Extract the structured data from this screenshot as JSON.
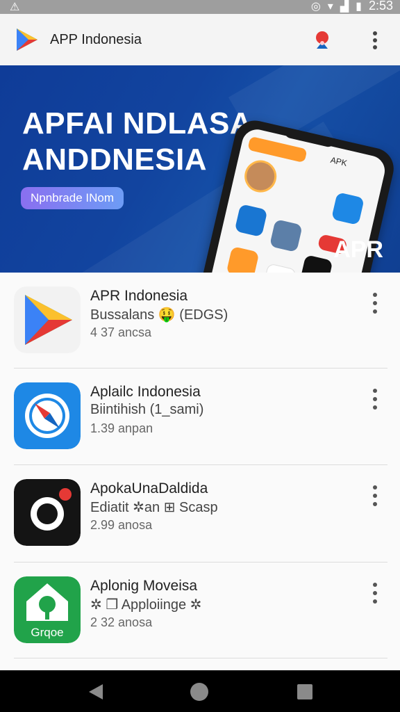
{
  "status_bar": {
    "time": "2:53"
  },
  "app_bar": {
    "title": "APP Indonesia"
  },
  "banner": {
    "headline": "APFAI NDLASA\nANDDNESIA",
    "pill": "Npnbrade INom",
    "corner_label": "APR",
    "phone_label": "APK"
  },
  "apps": [
    {
      "name": "APR Indonesia",
      "subtitle": "Bussalans 🤑 (EDGS)",
      "size": "4 37 ancsa",
      "icon": "play-store-icon"
    },
    {
      "name": "Aplailc Indonesia",
      "subtitle": "Biintihish (1_sami)",
      "size": "1.39 anpan",
      "icon": "compass-icon"
    },
    {
      "name": "ApokaUnaDaldida",
      "subtitle": "Ediatit ✲an ⊞ Scasp",
      "size": "2.99 anosa",
      "icon": "camera-lens-icon"
    },
    {
      "name": "Aplonig Moveisa",
      "subtitle": "✲ ❐ Apploiinge ✲",
      "size": "2 32 anosa",
      "icon": "tree-house-icon",
      "icon_text": "Grqoe"
    }
  ],
  "colors": {
    "banner_blue": "#12449f",
    "accent_orange": "#ff9a2a",
    "play_green": "#21a34a",
    "compass_blue": "#1e88e5"
  }
}
